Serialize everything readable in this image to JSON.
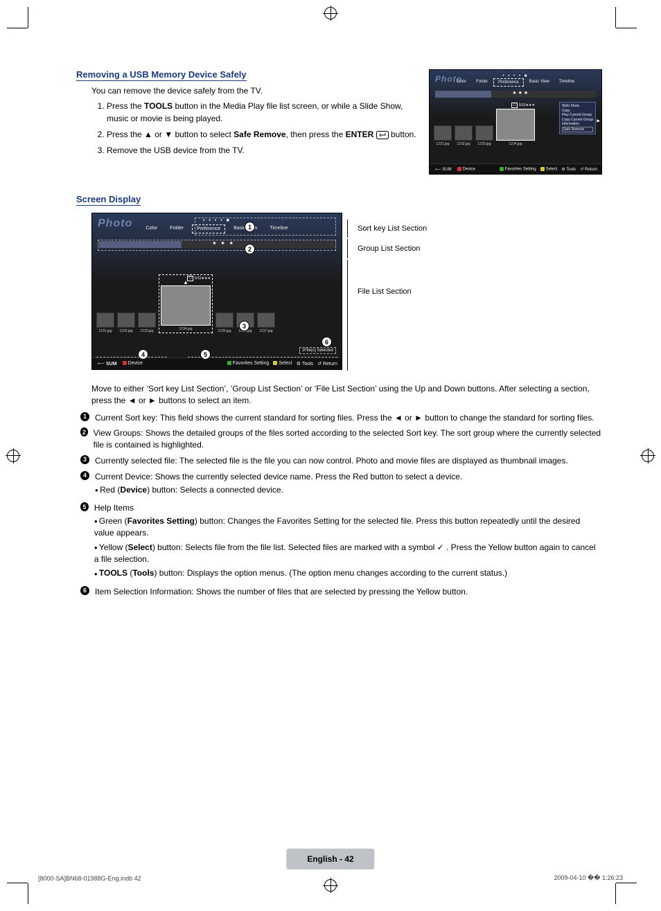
{
  "section1": {
    "title": "Removing a USB Memory Device Safely",
    "intro": "You can remove the device safely from the TV.",
    "steps": [
      {
        "pre": "Press the ",
        "bold1": "TOOLS",
        "post1": " button in the Media Play file list screen, or while a Slide Show, music or movie is being played."
      },
      {
        "pre": "Press the ▲ or ▼ button to select ",
        "bold1": "Safe Remove",
        "post1": ", then press the ",
        "bold2": "ENTER",
        "post2": " button."
      },
      {
        "pre": "Remove the USB device from the TV."
      }
    ]
  },
  "tv_small": {
    "title": "Photo",
    "tabs": [
      "Color",
      "Folder",
      "Preference",
      "Basic View",
      "Timeline"
    ],
    "counter": "5/15",
    "stars": "★★★",
    "thumbs": [
      "1231.jpg",
      "1232.jpg",
      "1233.jpg",
      "1234.jpg"
    ],
    "tools_menu": [
      "Slide Show",
      "Copy",
      "Play Current Group",
      "Copy Current Group",
      "Information",
      "Safe Remove"
    ],
    "footer_left": [
      "SUM",
      "Device"
    ],
    "footer_right": {
      "fav": "Favorites Setting",
      "select": "Select",
      "tools": "Tools",
      "return": "Return"
    }
  },
  "section2": {
    "title": "Screen Display",
    "labels": {
      "sort": "Sort key List Section",
      "group": "Group List Section",
      "file": "File List Section"
    }
  },
  "tv_large": {
    "title": "Photo",
    "tabs": [
      "Color",
      "Folder",
      "Preference",
      "Basic View",
      "Timeline"
    ],
    "counter": "5/15",
    "stars": "★★★",
    "groupbar_stars": "★ ★ ★",
    "selected_info": "1File(s) Selected",
    "thumbs": [
      "1231.jpg",
      "1232.jpg",
      "1233.jpg",
      "1234.jpg",
      "1235.jpg",
      "1236.jpg",
      "1237.jpg"
    ],
    "footer_left": [
      "SUM",
      "Device"
    ],
    "footer_right": {
      "fav": "Favorites Setting",
      "select": "Select",
      "tools": "Tools",
      "return": "Return"
    }
  },
  "description": {
    "intro": "Move to either ‘Sort key List Section’, ‘Group List Section’ or ‘File List Section’ using the Up and Down buttons. After selecting a section, press the ◄ or ► buttons to select an item.",
    "items": [
      {
        "text": "Current Sort key: This field shows the current standard for sorting files. Press the ◄ or ► button to change the standard for sorting files."
      },
      {
        "text": "View Groups: Shows the detailed groups of the files sorted according to the selected Sort key. The sort group where the currently selected file is contained is highlighted."
      },
      {
        "text": "Currently selected file: The selected file is the file you can now control. Photo and movie files are displayed as thumbnail images."
      },
      {
        "text": "Current Device: Shows the currently selected device name. Press the Red button to select a device.",
        "sub": [
          {
            "pre": "Red (",
            "bold": "Device",
            "post": ") button: Selects a connected device."
          }
        ]
      },
      {
        "text": "Help Items",
        "sub": [
          {
            "pre": "Green (",
            "bold": "Favorites Setting",
            "post": ") button: Changes the Favorites Setting for the selected file. Press this button repeatedly until the desired value appears."
          },
          {
            "pre": "Yellow (",
            "bold": "Select",
            "post": ") button: Selects file from the file list. Selected files are marked with a symbol ✓ . Press the Yellow button again to cancel a file selection."
          },
          {
            "boldpre": "TOOLS",
            "pre2": " (",
            "bold": "Tools",
            "post": ") button: Displays the option menus. (The option menu changes according to the current status.)"
          }
        ]
      },
      {
        "text": "Item Selection Information: Shows the number of files that are selected by pressing the Yellow button."
      }
    ]
  },
  "page_label": "English - 42",
  "foot_left": "[8000-SA]BN68-01988G-Eng.indb   42",
  "foot_right": "2009-04-10   �� 1:26:23"
}
